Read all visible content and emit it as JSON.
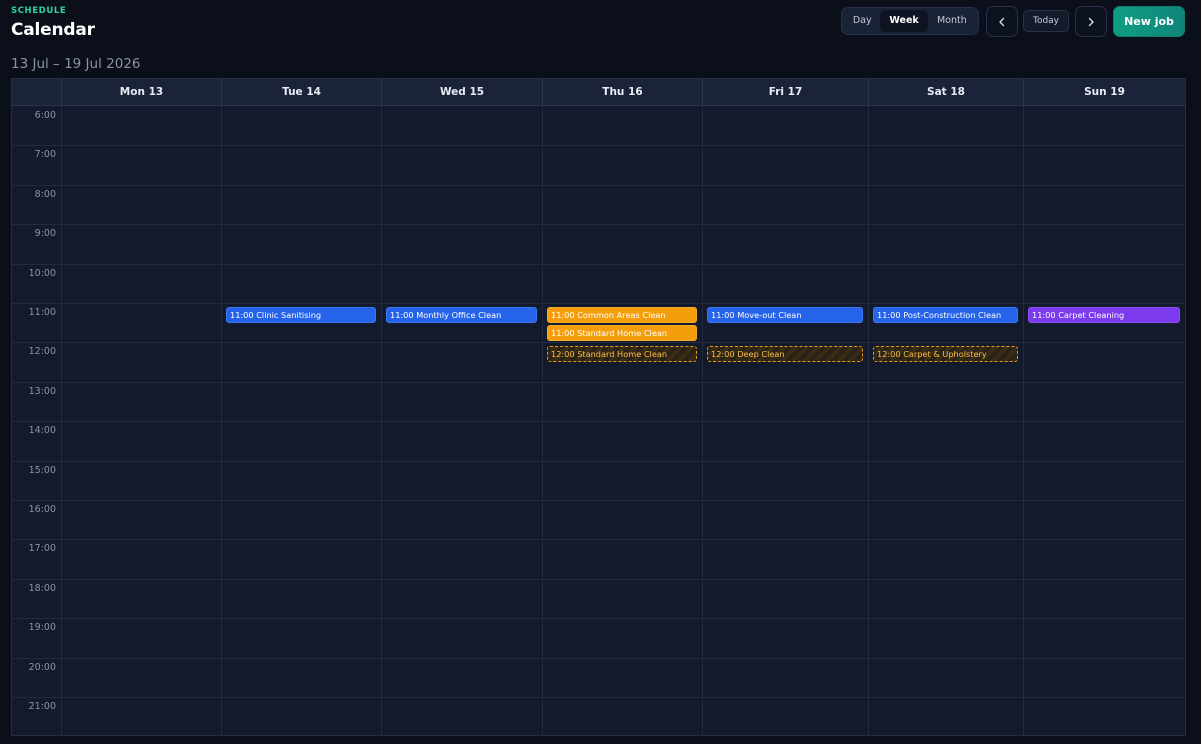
{
  "header": {
    "eyebrow": "SCHEDULE",
    "title": "Calendar",
    "date_range": "13 Jul – 19 Jul 2026"
  },
  "view_switch": {
    "options": [
      "Day",
      "Week",
      "Month"
    ],
    "selected": "Week"
  },
  "nav": {
    "prev_icon": "chevron-left-icon",
    "next_icon": "chevron-right-icon",
    "today_label": "Today",
    "new_job_label": "New job"
  },
  "colors": {
    "accent": "#0e9f82",
    "blue_event": "#2563eb",
    "orange_event": "#f59e0b",
    "purple_event": "#7c3aed"
  },
  "days": [
    "Mon 13",
    "Tue 14",
    "Wed 15",
    "Thu 16",
    "Fri 17",
    "Sat 18",
    "Sun 19"
  ],
  "hours": [
    "6:00",
    "7:00",
    "8:00",
    "9:00",
    "10:00",
    "11:00",
    "12:00",
    "13:00",
    "14:00",
    "15:00",
    "16:00",
    "17:00",
    "18:00",
    "19:00",
    "20:00",
    "21:00"
  ],
  "events": [
    {
      "day": 1,
      "hour": "11:00",
      "slot": 0,
      "label": "11:00 Clinic Sanitising",
      "style": "blue"
    },
    {
      "day": 2,
      "hour": "11:00",
      "slot": 0,
      "label": "11:00 Monthly Office Clean",
      "style": "blue"
    },
    {
      "day": 3,
      "hour": "11:00",
      "slot": 0,
      "label": "11:00 Common Areas Clean",
      "style": "orange"
    },
    {
      "day": 3,
      "hour": "11:00",
      "slot": 1,
      "label": "11:00 Standard Home Clean",
      "style": "orange"
    },
    {
      "day": 3,
      "hour": "12:00",
      "slot": 0,
      "label": "12:00 Standard Home Clean",
      "style": "dashed"
    },
    {
      "day": 4,
      "hour": "11:00",
      "slot": 0,
      "label": "11:00 Move-out Clean",
      "style": "blue"
    },
    {
      "day": 4,
      "hour": "12:00",
      "slot": 0,
      "label": "12:00 Deep Clean",
      "style": "dashed"
    },
    {
      "day": 5,
      "hour": "11:00",
      "slot": 0,
      "label": "11:00 Post-Construction Clean",
      "style": "blue"
    },
    {
      "day": 5,
      "hour": "12:00",
      "slot": 0,
      "label": "12:00 Carpet & Upholstery",
      "style": "dashed"
    },
    {
      "day": 6,
      "hour": "11:00",
      "slot": 0,
      "label": "11:00 Carpet Cleaning",
      "style": "purple"
    }
  ]
}
